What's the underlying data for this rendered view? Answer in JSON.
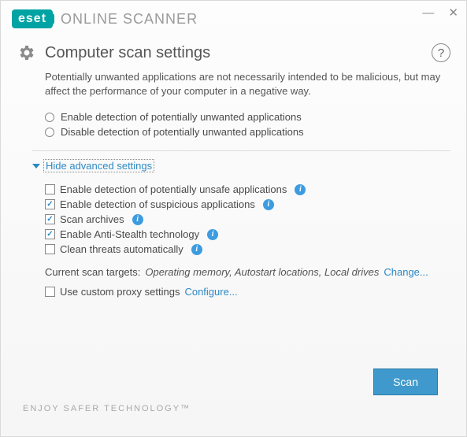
{
  "header": {
    "brand": "eset",
    "product": "ONLINE SCANNER"
  },
  "page": {
    "title": "Computer scan settings",
    "description": "Potentially unwanted applications are not necessarily intended to be malicious, but may affect the performance of your computer in a negative way."
  },
  "pua_radios": {
    "enable": "Enable detection of potentially unwanted applications",
    "disable": "Disable detection of potentially unwanted applications"
  },
  "advanced": {
    "toggle_label": "Hide advanced settings",
    "options": [
      {
        "label": "Enable detection of potentially unsafe applications",
        "checked": false,
        "info": true
      },
      {
        "label": "Enable detection of suspicious applications",
        "checked": true,
        "info": true
      },
      {
        "label": "Scan archives",
        "checked": true,
        "info": true
      },
      {
        "label": "Enable Anti-Stealth technology",
        "checked": true,
        "info": true
      },
      {
        "label": "Clean threats automatically",
        "checked": false,
        "info": true
      }
    ]
  },
  "targets": {
    "label": "Current scan targets:",
    "value": "Operating memory, Autostart locations, Local drives",
    "change_link": "Change..."
  },
  "proxy": {
    "label": "Use custom proxy settings",
    "checked": false,
    "configure_link": "Configure..."
  },
  "actions": {
    "scan": "Scan"
  },
  "footer": {
    "tagline": "ENJOY SAFER TECHNOLOGY™"
  }
}
